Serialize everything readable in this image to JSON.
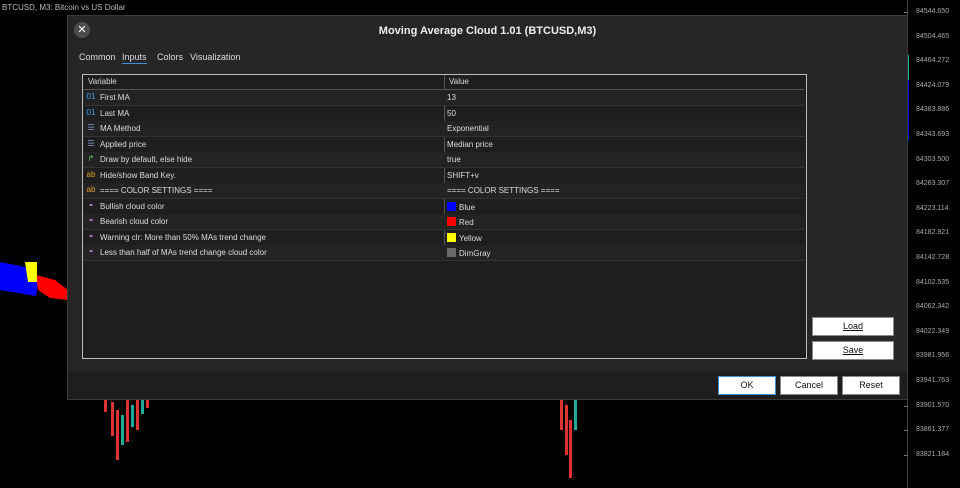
{
  "chart": {
    "title": "BTCUSD, M3:  Bitcoin vs US Dollar",
    "price_labels": [
      "84544.650",
      "84504.465",
      "84464.272",
      "84424.079",
      "84383.886",
      "84343.693",
      "84303.500",
      "84263.307",
      "84223.114",
      "84182.921",
      "84142.728",
      "84102.535",
      "84062.342",
      "84022.349",
      "83981.956",
      "83941.763",
      "83901.570",
      "83861.377",
      "83821.184"
    ]
  },
  "dialog": {
    "title": "Moving Average Cloud 1.01 (BTCUSD,M3)",
    "close_symbol": "✕",
    "tabs": [
      "Common",
      "Inputs",
      "Colors",
      "Visualization"
    ],
    "active_tab": "Inputs",
    "table": {
      "header_variable": "Variable",
      "header_value": "Value",
      "rows": [
        {
          "icon": "01",
          "icon_name": "integer-icon",
          "icon_color": "#4a9be8",
          "variable": "First MA",
          "value": "13"
        },
        {
          "icon": "01",
          "icon_name": "integer-icon",
          "icon_color": "#4a9be8",
          "variable": "Last MA",
          "value": "50"
        },
        {
          "icon": "☰",
          "icon_name": "enum-icon",
          "icon_color": "#8a9ad8",
          "variable": "MA Method",
          "value": "Exponential"
        },
        {
          "icon": "☰",
          "icon_name": "enum-icon",
          "icon_color": "#8a9ad8",
          "variable": "Applied price",
          "value": "Median price"
        },
        {
          "icon": "↱",
          "icon_name": "bool-icon",
          "icon_color": "#5ec25e",
          "variable": "Draw by default, else hide",
          "value": "true"
        },
        {
          "icon": "ab",
          "icon_name": "string-icon",
          "icon_color": "#e0a030",
          "variable": "Hide/show Band Key.",
          "value": "SHIFT+v"
        },
        {
          "icon": "ab",
          "icon_name": "string-icon",
          "icon_color": "#e0a030",
          "variable": "==== COLOR SETTINGS ====",
          "value": "==== COLOR SETTINGS ===="
        },
        {
          "icon": "◓",
          "icon_name": "color-icon",
          "icon_color": "#c08ad8",
          "variable": "Bullish cloud color",
          "value": "Blue",
          "swatch": "#0000ff"
        },
        {
          "icon": "◓",
          "icon_name": "color-icon",
          "icon_color": "#c08ad8",
          "variable": "Bearish cloud color",
          "value": "Red",
          "swatch": "#ff0000"
        },
        {
          "icon": "◓",
          "icon_name": "color-icon",
          "icon_color": "#c08ad8",
          "variable": "Warning clr: More than 50% MAs trend change",
          "value": "Yellow",
          "swatch": "#ffff00"
        },
        {
          "icon": "◓",
          "icon_name": "color-icon",
          "icon_color": "#c08ad8",
          "variable": "Less than half of MAs trend change cloud color",
          "value": "DimGray",
          "swatch": "#696969"
        }
      ]
    },
    "load_label": "Load",
    "save_label": "Save",
    "ok_label": "OK",
    "cancel_label": "Cancel",
    "reset_label": "Reset"
  }
}
